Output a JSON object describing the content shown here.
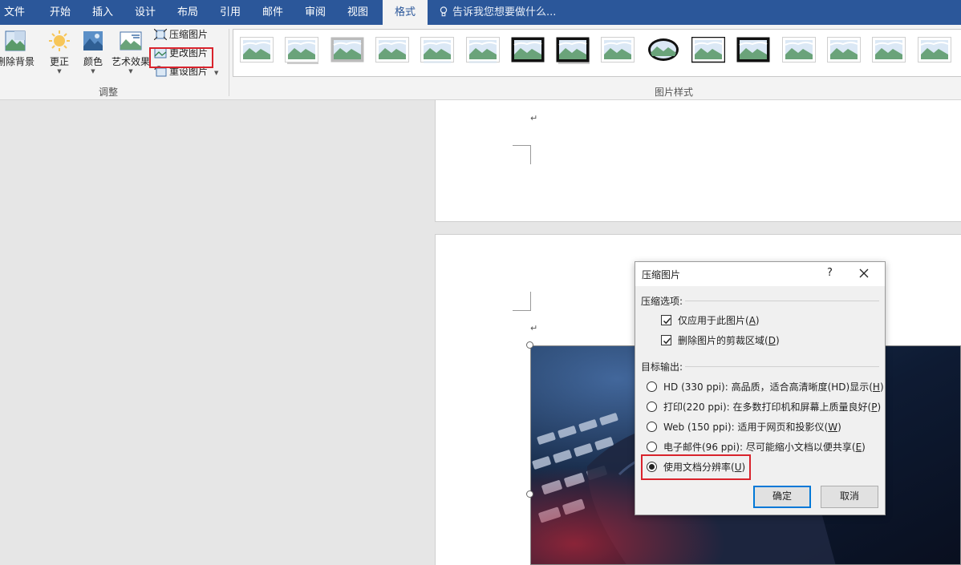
{
  "menu": {
    "tabs": [
      "文件",
      "开始",
      "插入",
      "设计",
      "布局",
      "引用",
      "邮件",
      "审阅",
      "视图",
      "格式"
    ],
    "active_tab": "格式",
    "tell_me": "告诉我您想要做什么..."
  },
  "ribbon": {
    "remove_background": "删除背景",
    "corrections": "更正",
    "color": "颜色",
    "artistic_effects": "艺术效果",
    "compress_pictures": "压缩图片",
    "change_picture": "更改图片",
    "reset_picture": "重设图片",
    "adjust_group": "调整",
    "styles_group": "图片样式",
    "style_count": 16
  },
  "document": {
    "paragraph_mark": "↵"
  },
  "dialog": {
    "title": "压缩图片",
    "help": "?",
    "compression_options_heading": "压缩选项:",
    "apply_only_text": "仅应用于此图片",
    "apply_only_key": "A",
    "apply_only_checked": true,
    "delete_cropped_text": "删除图片的剪裁区域",
    "delete_cropped_key": "D",
    "delete_cropped_checked": true,
    "target_output_heading": "目标输出:",
    "options": [
      {
        "text": "HD (330 ppi): 高品质，适合高清晰度(HD)显示",
        "key": "H",
        "selected": false
      },
      {
        "text": "打印(220 ppi): 在多数打印机和屏幕上质量良好",
        "key": "P",
        "selected": false
      },
      {
        "text": "Web (150 ppi): 适用于网页和投影仪",
        "key": "W",
        "selected": false
      },
      {
        "text": "电子邮件(96 ppi): 尽可能缩小文档以便共享",
        "key": "E",
        "selected": false
      },
      {
        "text": "使用文档分辨率",
        "key": "U",
        "selected": true
      }
    ],
    "ok": "确定",
    "cancel": "取消"
  },
  "colors": {
    "title_bar": "#2b579a",
    "highlight": "#d9232c",
    "default_button_border": "#0078d7"
  }
}
